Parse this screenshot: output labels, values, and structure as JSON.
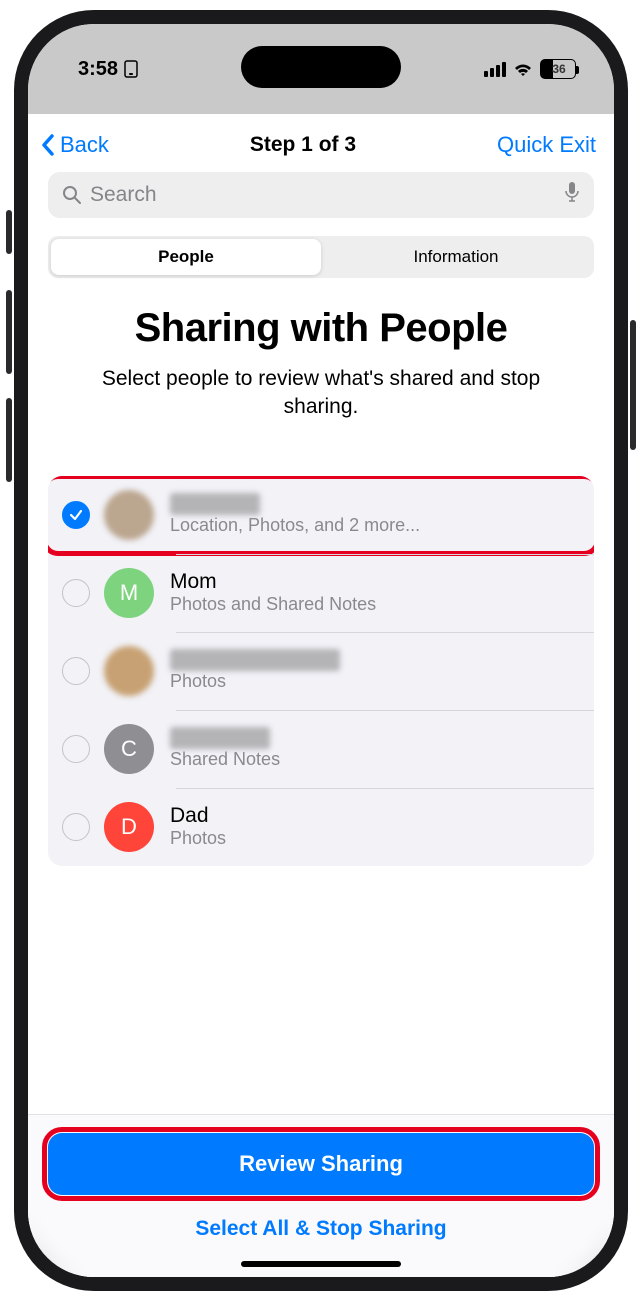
{
  "status": {
    "time": "3:58",
    "battery": "36"
  },
  "nav": {
    "back": "Back",
    "title": "Step 1 of 3",
    "exit": "Quick Exit"
  },
  "search": {
    "placeholder": "Search"
  },
  "tabs": {
    "people": "People",
    "information": "Information"
  },
  "header": {
    "title": "Sharing with People",
    "subtitle": "Select people to review what's shared and stop sharing."
  },
  "people": [
    {
      "name": "",
      "subtitle": "Location, Photos, and 2 more...",
      "selected": true,
      "avatar_style": "blurred",
      "avatar_text": "",
      "highlighted": true,
      "name_blurred": true
    },
    {
      "name": "Mom",
      "subtitle": "Photos and Shared Notes",
      "selected": false,
      "avatar_style": "color",
      "avatar_text": "M",
      "avatar_color": "#7ed37e",
      "name_blurred": false
    },
    {
      "name": "",
      "subtitle": "Photos",
      "selected": false,
      "avatar_style": "blurred2",
      "avatar_text": "",
      "name_blurred": true,
      "name_blur_variant": "wide"
    },
    {
      "name": "",
      "subtitle": "Shared Notes",
      "selected": false,
      "avatar_style": "color",
      "avatar_text": "C",
      "avatar_color": "#8e8e93",
      "name_blurred": true,
      "name_blur_variant": "medium"
    },
    {
      "name": "Dad",
      "subtitle": "Photos",
      "selected": false,
      "avatar_style": "color",
      "avatar_text": "D",
      "avatar_color": "#ff453a",
      "name_blurred": false
    }
  ],
  "actions": {
    "primary": "Review Sharing",
    "secondary": "Select All & Stop Sharing"
  }
}
